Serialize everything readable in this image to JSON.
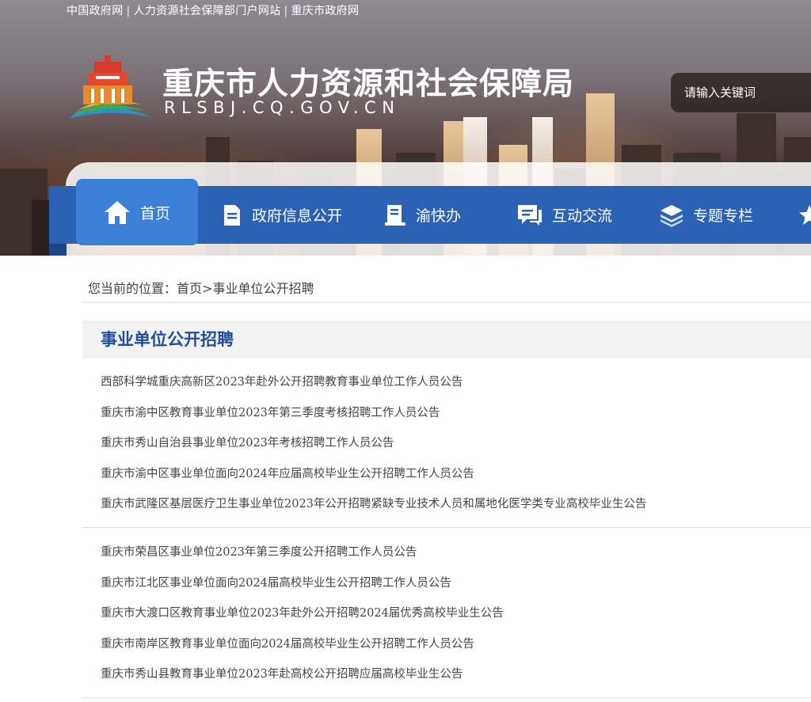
{
  "top_links": [
    "中国政府网",
    "人力资源社会保障部门户网站",
    "重庆市政府网"
  ],
  "site": {
    "title": "重庆市人力资源和社会保障局",
    "domain": "RLSBJ.CQ.GOV.CN"
  },
  "search": {
    "placeholder": "请输入关键词"
  },
  "nav": {
    "items": [
      {
        "label": "首页",
        "icon": "home-icon",
        "active": true
      },
      {
        "label": "政府信息公开",
        "icon": "document-icon"
      },
      {
        "label": "渝快办",
        "icon": "book-icon"
      },
      {
        "label": "互动交流",
        "icon": "chat-icon"
      },
      {
        "label": "专题专栏",
        "icon": "layers-icon"
      },
      {
        "icon": "star-icon"
      }
    ]
  },
  "breadcrumb": {
    "prefix": "您当前的位置：",
    "home": "首页",
    "separator": ">",
    "current": "事业单位公开招聘"
  },
  "section": {
    "title": "事业单位公开招聘",
    "group1": [
      "西部科学城重庆高新区2023年赴外公开招聘教育事业单位工作人员公告",
      "重庆市渝中区教育事业单位2023年第三季度考核招聘工作人员公告",
      "重庆市秀山自治县事业单位2023年考核招聘工作人员公告",
      "重庆市渝中区事业单位面向2024年应届高校毕业生公开招聘工作人员公告",
      "重庆市武隆区基层医疗卫生事业单位2023年公开招聘紧缺专业技术人员和属地化医学类专业高校毕业生公告"
    ],
    "group2": [
      "重庆市荣昌区事业单位2023年第三季度公开招聘工作人员公告",
      "重庆市江北区事业单位面向2024届高校毕业生公开招聘工作人员公告",
      "重庆市大渡口区教育事业单位2023年赴外公开招聘2024届优秀高校毕业生公告",
      "重庆市南岸区教育事业单位面向2024届高校毕业生公开招聘工作人员公告",
      "重庆市秀山县教育事业单位2023年赴高校公开招聘应届高校毕业生公告"
    ]
  },
  "colors": {
    "nav_bg": "#2c62b4",
    "nav_active": "#3b7fd6",
    "section_title": "#1f4f99"
  }
}
